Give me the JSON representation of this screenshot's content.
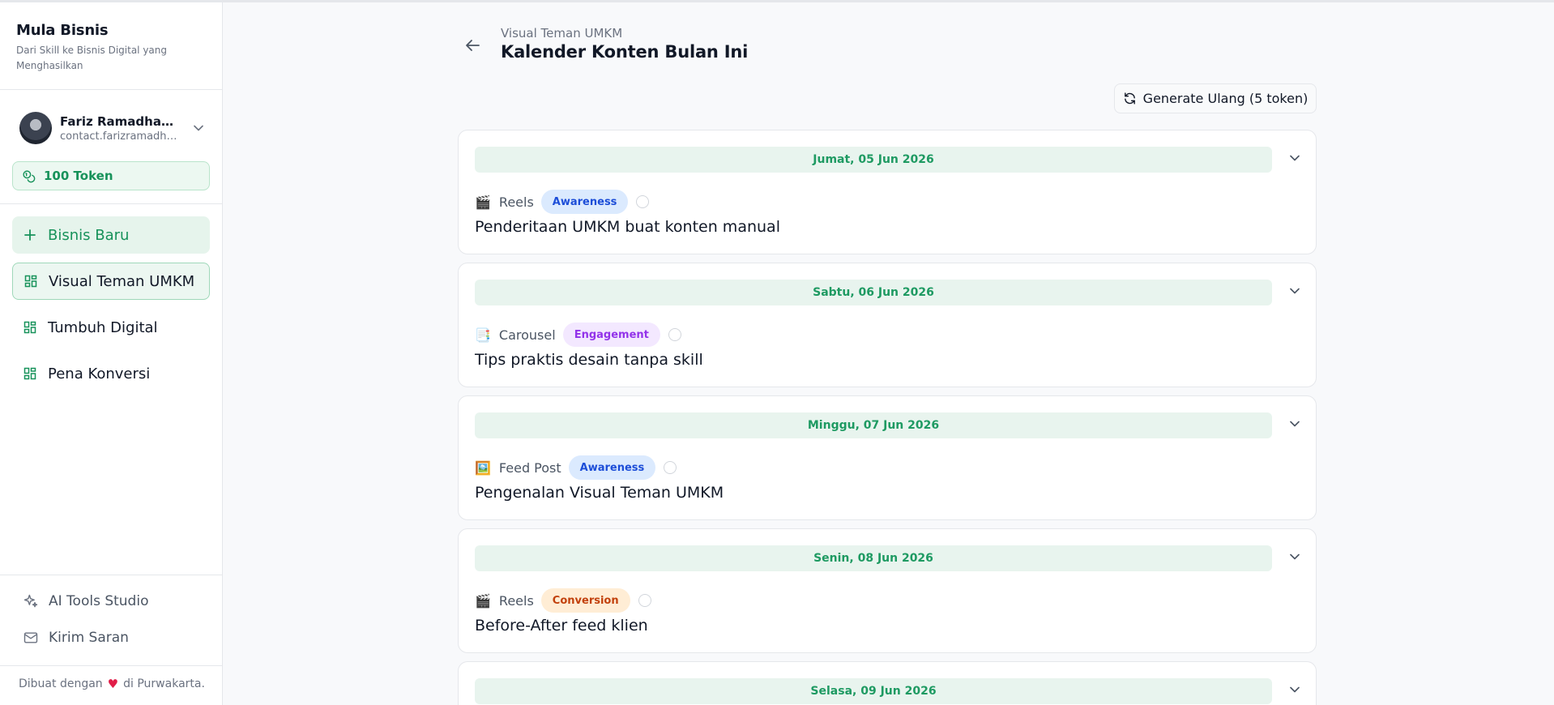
{
  "sidebar": {
    "brand_title": "Mula Bisnis",
    "brand_subtitle": "Dari Skill ke Bisnis Digital yang Menghasilkan",
    "profile_name": "Fariz Ramadhan (...",
    "profile_email": "contact.farizramadha...",
    "token_label": "100 Token",
    "new_business_label": "Bisnis Baru",
    "businesses": [
      "Visual Teman UMKM",
      "Tumbuh Digital",
      "Pena Konversi"
    ],
    "ai_tools_label": "AI Tools Studio",
    "feedback_label": "Kirim Saran",
    "footer_before": "Dibuat dengan",
    "footer_after": "di Purwakarta."
  },
  "header": {
    "breadcrumb": "Visual Teman UMKM",
    "title": "Kalender Konten Bulan Ini"
  },
  "regenerate_label": "Generate Ulang (5 token)",
  "colors": {
    "accent_green": "#17925a",
    "awareness": "#1d4ed8",
    "engagement": "#9333ea",
    "conversion": "#c2410c"
  },
  "cards": [
    {
      "date": "Jumat, 05 Jun 2026",
      "icon": "clapper-emoji",
      "emoji": "🎬",
      "type": "Reels",
      "badge": "Awareness",
      "title": "Penderitaan UMKM buat konten manual"
    },
    {
      "date": "Sabtu, 06 Jun 2026",
      "icon": "memo-emoji",
      "emoji": "📑",
      "type": "Carousel",
      "badge": "Engagement",
      "title": "Tips praktis desain tanpa skill"
    },
    {
      "date": "Minggu, 07 Jun 2026",
      "icon": "picture-emoji",
      "emoji": "🖼️",
      "type": "Feed Post",
      "badge": "Awareness",
      "title": "Pengenalan Visual Teman UMKM"
    },
    {
      "date": "Senin, 08 Jun 2026",
      "icon": "clapper-emoji",
      "emoji": "🎬",
      "type": "Reels",
      "badge": "Conversion",
      "title": "Before-After feed klien"
    },
    {
      "date": "Selasa, 09 Jun 2026"
    }
  ]
}
